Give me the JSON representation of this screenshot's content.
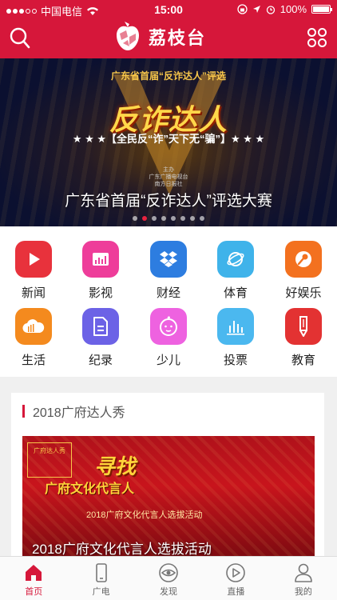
{
  "status_bar": {
    "carrier": "中国电信",
    "time": "15:00",
    "battery": "100%"
  },
  "header": {
    "app_name": "荔枝台",
    "accent": "#d6173a"
  },
  "banner": {
    "top_tag": "广东省首届“反诈达人”评选",
    "big_title": "反诈达人",
    "slogan": "★ ★ ★【全民反“诈”天下无“骗”】★ ★ ★",
    "org_line1": "主办",
    "org_line2": "广东广播电视台",
    "org_line3": "南方日报社",
    "caption": "广东省首届“反诈达人”评选大赛",
    "active_page": 1
  },
  "categories": [
    {
      "label": "新闻",
      "icon": "play-icon",
      "color": "#e8323c"
    },
    {
      "label": "影视",
      "icon": "video-bars-icon",
      "color": "#ee3d9a"
    },
    {
      "label": "财经",
      "icon": "dropbox-icon",
      "color": "#2d7de0"
    },
    {
      "label": "体育",
      "icon": "planet-icon",
      "color": "#3fb3ea"
    },
    {
      "label": "好娱乐",
      "icon": "microphone-icon",
      "color": "#f3711f"
    },
    {
      "label": "生活",
      "icon": "cloud-icon",
      "color": "#f48a1e"
    },
    {
      "label": "纪录",
      "icon": "document-icon",
      "color": "#6c62e6"
    },
    {
      "label": "少儿",
      "icon": "baby-face-icon",
      "color": "#ee62e0"
    },
    {
      "label": "投票",
      "icon": "bar-chart-icon",
      "color": "#4bb8ef"
    },
    {
      "label": "教育",
      "icon": "pen-icon",
      "color": "#e33232"
    }
  ],
  "featured": {
    "section_title": "2018广府达人秀",
    "image_title": "寻找",
    "image_subtitle": "广府文化代言人",
    "image_line": "2018广府文化代言人选拔活动",
    "image_badge": "广府达人秀",
    "caption": "2018广府文化代言人选拔活动"
  },
  "tabbar": [
    {
      "label": "首页",
      "icon": "home-icon",
      "active": true
    },
    {
      "label": "广电",
      "icon": "phone-icon",
      "active": false
    },
    {
      "label": "发现",
      "icon": "eye-icon",
      "active": false
    },
    {
      "label": "直播",
      "icon": "play-circle-icon",
      "active": false
    },
    {
      "label": "我的",
      "icon": "user-icon",
      "active": false
    }
  ]
}
